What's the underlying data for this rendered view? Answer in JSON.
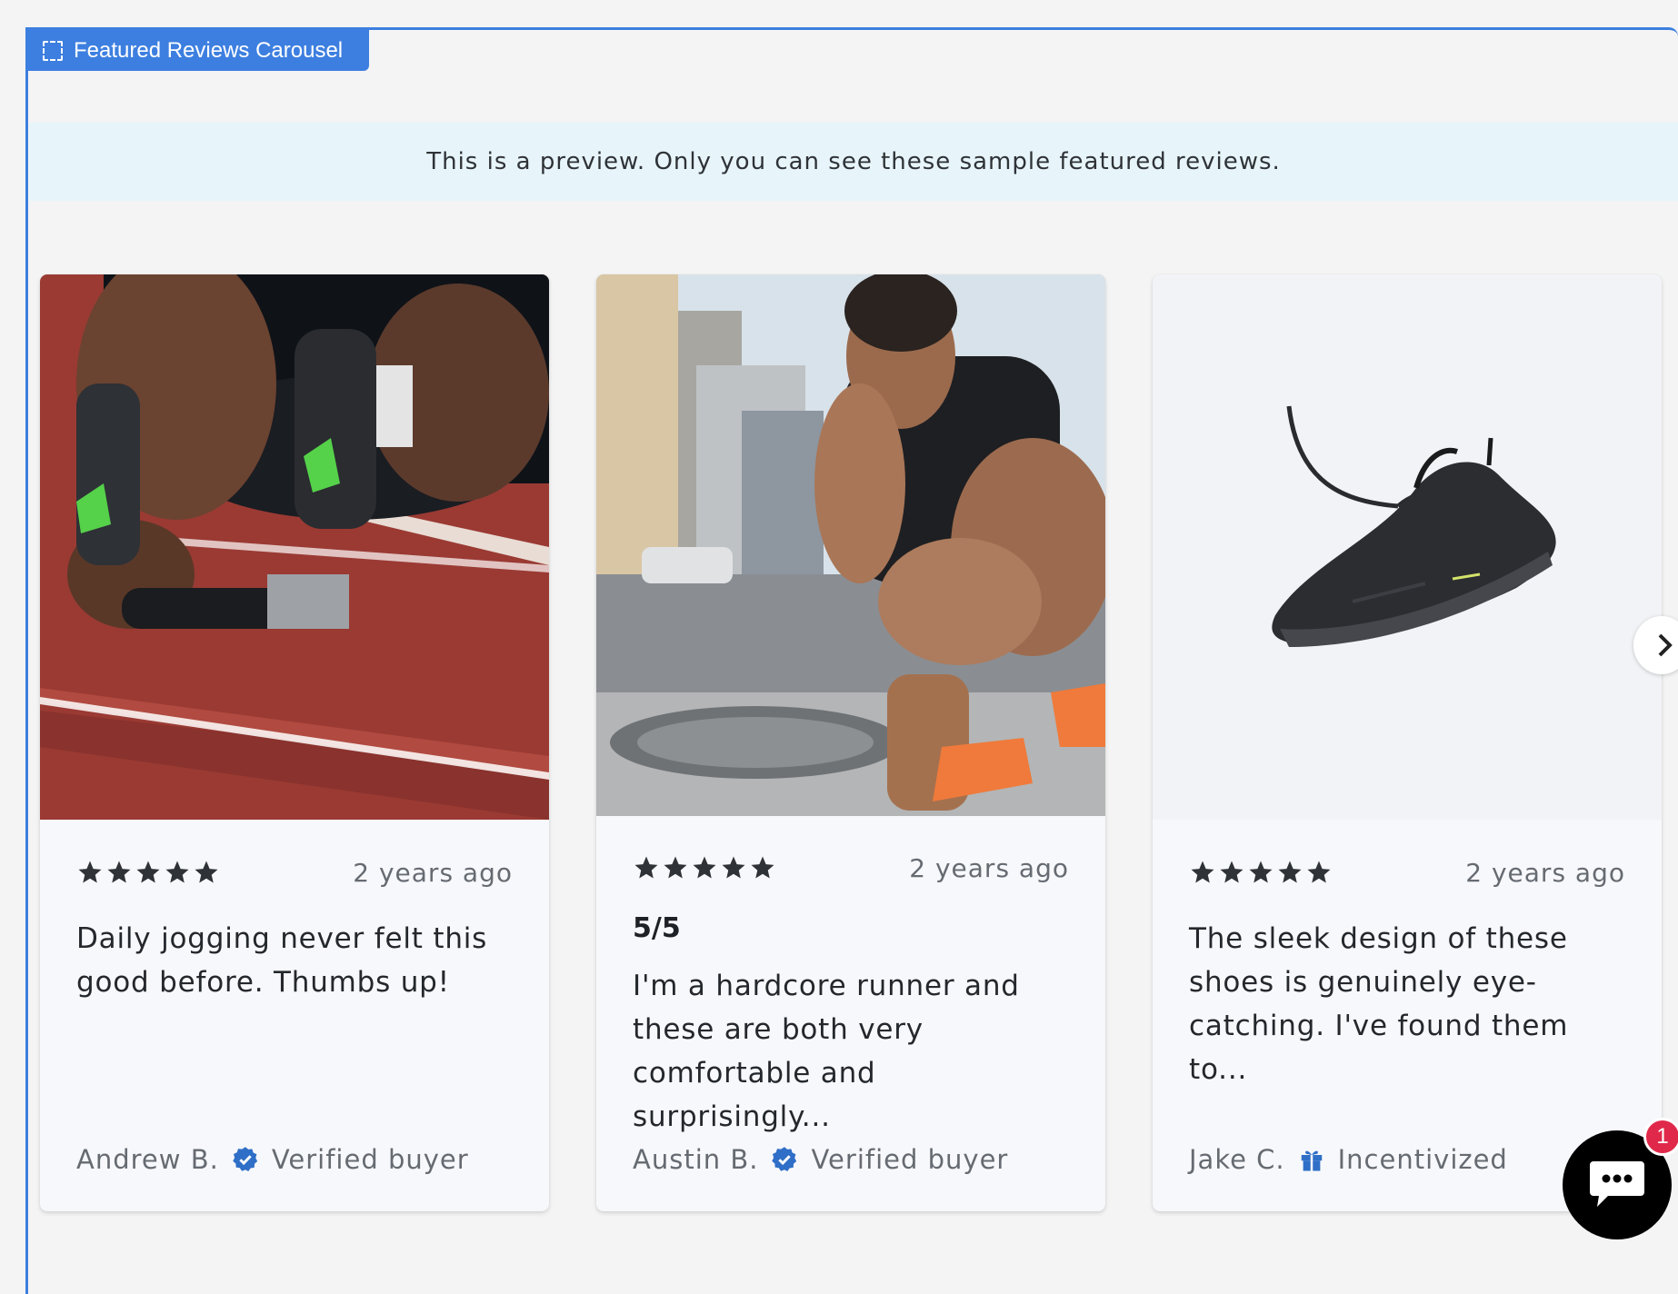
{
  "section_tag": {
    "label": "Featured Reviews Carousel",
    "icon": "dashed-frame-icon"
  },
  "preview_banner": {
    "text": "This is a preview. Only you can see these sample featured reviews."
  },
  "reviews": [
    {
      "image": "runner-in-starting-blocks-photo",
      "rating": 5,
      "date": "2 years ago",
      "title": "",
      "text": "Daily jogging never felt this good before. Thumbs up!",
      "author": "Andrew B.",
      "badge": "Verified buyer",
      "badge_icon": "verified-check-icon"
    },
    {
      "image": "runner-tying-shoe-photo",
      "rating": 5,
      "date": "2 years ago",
      "title": "5/5",
      "text": "I'm a hardcore runner and these are both very comfortable and surprisingly...",
      "author": "Austin B.",
      "badge": "Verified buyer",
      "badge_icon": "verified-check-icon"
    },
    {
      "image": "black-running-shoe-photo",
      "rating": 5,
      "date": "2 years ago",
      "title": "",
      "text": "The sleek design of these shoes is genuinely eye-catching. I've found them to...",
      "author": "Jake C.",
      "badge": "Incentivized",
      "badge_icon": "gift-icon"
    }
  ],
  "carousel": {
    "next_icon": "chevron-right-icon"
  },
  "chat": {
    "icon": "chat-bubble-icon",
    "badge_count": "1"
  },
  "colors": {
    "accent": "#3d7fe0",
    "banner_bg": "#e7f5fb",
    "star": "#2f3236",
    "verified": "#2f6fc7",
    "chat_badge": "#e0294a"
  }
}
